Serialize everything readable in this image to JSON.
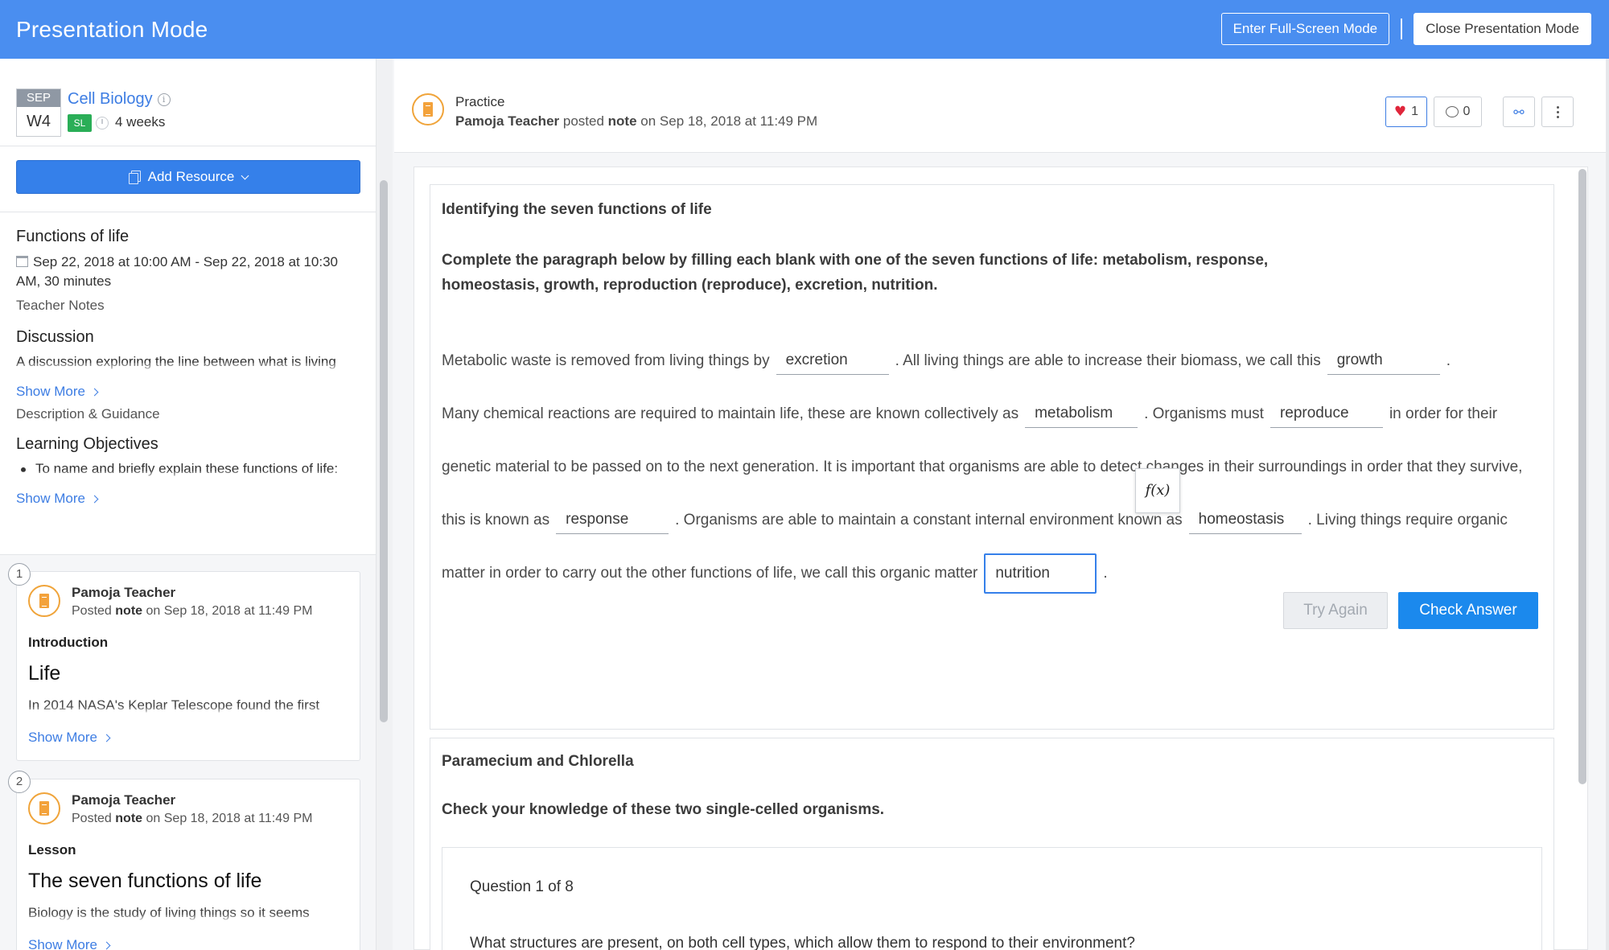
{
  "topbar": {
    "title": "Presentation Mode",
    "fullscreen_label": "Enter Full-Screen Mode",
    "close_label": "Close Presentation Mode"
  },
  "sidebar": {
    "month": "SEP",
    "week": "W4",
    "course_title": "Cell Biology",
    "level_badge": "SL",
    "duration": "4 weeks",
    "add_resource_label": "Add Resource",
    "event": {
      "title": "Functions of life",
      "datetime": "Sep 22, 2018 at 10:00 AM - Sep 22, 2018 at 10:30 AM, 30 minutes",
      "teacher_notes_label": "Teacher Notes"
    },
    "discussion": {
      "heading": "Discussion",
      "text": "A discussion exploring the line between what is living and what is not",
      "show_more": "Show More"
    },
    "description_label": "Description & Guidance",
    "objectives": {
      "heading": "Learning Objectives",
      "item": "To name and briefly explain these functions of life: nutrition, metabolism, growth, response",
      "show_more": "Show More"
    },
    "feed": [
      {
        "number": "1",
        "author": "Pamoja Teacher",
        "posted": "Posted",
        "type": "note",
        "date": "on Sep 18, 2018 at 11:49 PM",
        "category": "Introduction",
        "title": "Life",
        "snippet": "In 2014 NASA's Keplar Telescope found the first",
        "show_more": "Show More"
      },
      {
        "number": "2",
        "author": "Pamoja Teacher",
        "posted": "Posted",
        "type": "note",
        "date": "on Sep 18, 2018 at 11:49 PM",
        "category": "Lesson",
        "title": "The seven functions of life",
        "snippet": "Biology is the study of living things so it seems",
        "show_more": "Show More"
      }
    ]
  },
  "post": {
    "kind": "Practice",
    "author": "Pamoja Teacher",
    "posted": "posted",
    "type": "note",
    "date": "on Sep 18, 2018 at 11:49 PM",
    "likes": "1",
    "comments": "0",
    "link_icon": "link-icon",
    "menu_icon": "more-vertical-icon"
  },
  "exercise1": {
    "title": "Identifying the seven functions of life",
    "instructions": "Complete the paragraph below by filling each blank with one of the seven functions of life: metabolism, response, homeostasis, growth, reproduction (reproduce), excretion, nutrition.",
    "t1": "Metabolic waste is removed from living things by",
    "a1": "excretion",
    "t2": ". All living things are able to increase their biomass, we call this",
    "a2": "growth",
    "t3": ".",
    "t4": "Many chemical reactions are required to maintain life, these are known collectively as",
    "a3": "metabolism",
    "t5": ". Organisms must",
    "a4": "reproduce",
    "t6": "in order for their genetic material to be passed on to the next generation. It is important that organisms are able to detect changes in their surroundings in order that they survive, this is known as",
    "a5": "response",
    "t7": ". Organisms are able to maintain a constant internal environment known as",
    "a6": "homeostasis",
    "t8": ". Living things require organic matter in order to carry out the other functions of life, we call this organic matter",
    "a7": "nutrition",
    "t9": ".",
    "fx_label": "f(x)",
    "try_again": "Try Again",
    "check_answer": "Check Answer"
  },
  "exercise2": {
    "title": "Paramecium and Chlorella",
    "subtitle": "Check your knowledge of these two single-celled organisms.",
    "question_number": "Question 1 of 8",
    "question": "What structures are present, on both cell types, which allow them to respond to their environment?"
  }
}
